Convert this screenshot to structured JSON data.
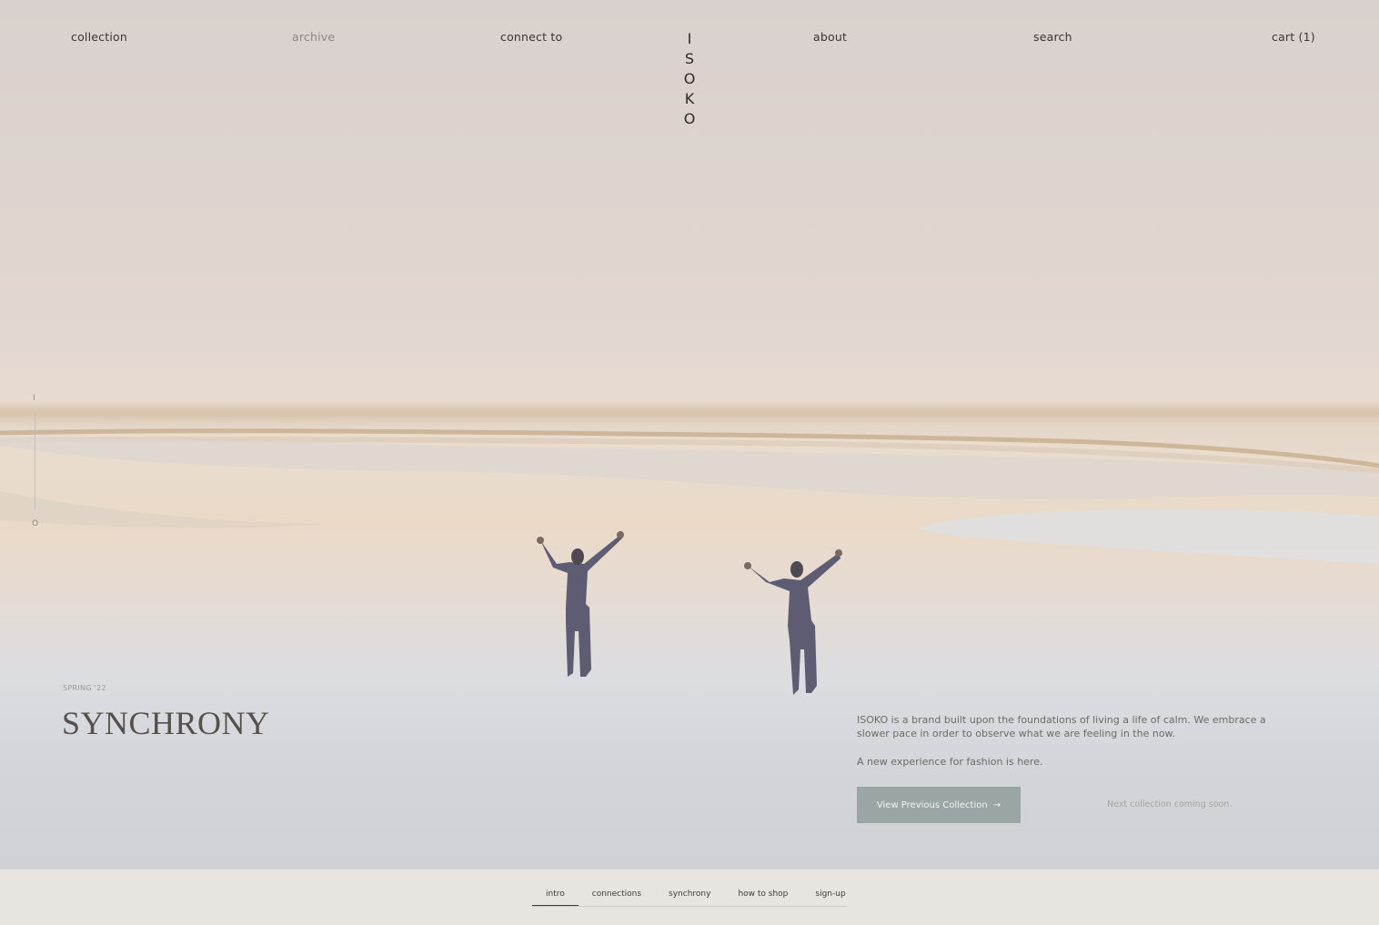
{
  "nav": {
    "collection": "collection",
    "archive": "archive",
    "connect": "connect to",
    "about": "about",
    "search": "search",
    "cart": "cart (1)"
  },
  "logo": [
    "I",
    "S",
    "O",
    "K",
    "O"
  ],
  "side_indicator": {
    "top": "I",
    "bottom": "O"
  },
  "hero": {
    "season": "SPRING '22",
    "title": "SYNCHRONY",
    "paragraph1": "ISOKO is a brand built upon the foundations of living a life of calm. We embrace a slower pace in order to observe what we are feeling in the now.",
    "paragraph2": "A new experience for fashion is here.",
    "button_label": "View Previous Collection",
    "button_arrow": "→",
    "next_note": "Next collection coming soon."
  },
  "tabs": [
    "intro",
    "connections",
    "synchrony",
    "how to shop",
    "sign-up"
  ],
  "colors": {
    "button_bg": "#9aa6a5",
    "figure_suit": "#57566b",
    "page_bg": "#e8e4df"
  }
}
